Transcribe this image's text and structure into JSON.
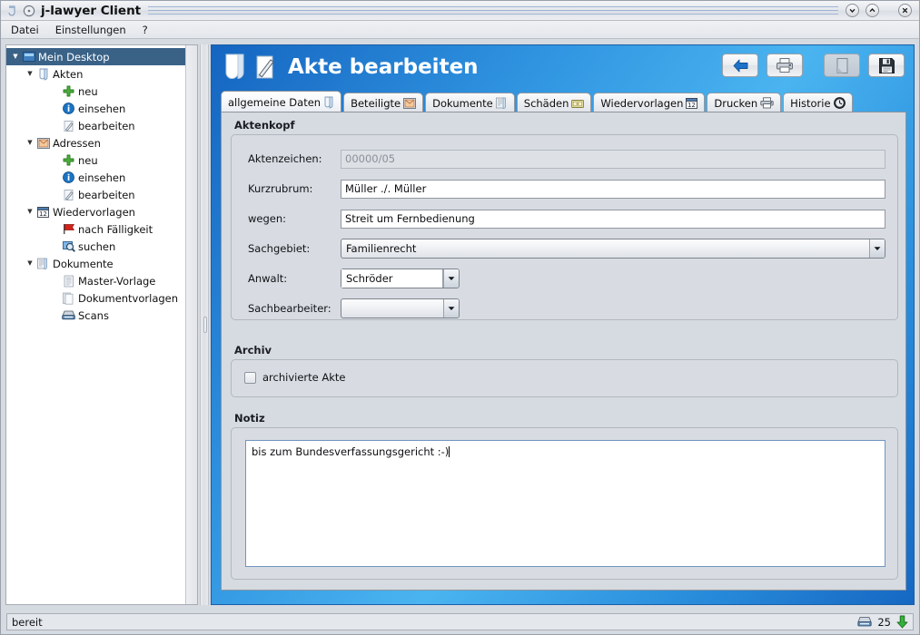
{
  "window": {
    "title": "j-lawyer Client",
    "controls": [
      {
        "name": "minimize-button",
        "glyph": "⌵"
      },
      {
        "name": "maximize-button",
        "glyph": "⌃"
      },
      {
        "name": "close-button",
        "glyph": "✕"
      }
    ]
  },
  "menubar": {
    "items": [
      {
        "label": "Datei",
        "name": "menu-datei"
      },
      {
        "label": "Einstellungen",
        "name": "menu-einstellungen"
      },
      {
        "label": "?",
        "name": "menu-help"
      }
    ]
  },
  "sidebar": {
    "items": [
      {
        "label": "Mein Desktop",
        "level": 1,
        "icon": "desktop-icon",
        "twisty": "▼",
        "selected": true
      },
      {
        "label": "Akten",
        "level": 2,
        "icon": "folder-icon",
        "twisty": "▼",
        "selected": false
      },
      {
        "label": "neu",
        "level": 3,
        "icon": "plus-icon",
        "twisty": "",
        "selected": false
      },
      {
        "label": "einsehen",
        "level": 3,
        "icon": "info-icon",
        "twisty": "",
        "selected": false
      },
      {
        "label": "bearbeiten",
        "level": 3,
        "icon": "edit-icon",
        "twisty": "",
        "selected": false
      },
      {
        "label": "Adressen",
        "level": 2,
        "icon": "addressbook-icon",
        "twisty": "▼",
        "selected": false
      },
      {
        "label": "neu",
        "level": 3,
        "icon": "plus-icon",
        "twisty": "",
        "selected": false
      },
      {
        "label": "einsehen",
        "level": 3,
        "icon": "info-icon",
        "twisty": "",
        "selected": false
      },
      {
        "label": "bearbeiten",
        "level": 3,
        "icon": "edit-icon",
        "twisty": "",
        "selected": false
      },
      {
        "label": "Wiedervorlagen",
        "level": 2,
        "icon": "calendar-icon",
        "twisty": "▼",
        "selected": false
      },
      {
        "label": "nach Fälligkeit",
        "level": 3,
        "icon": "flag-icon",
        "twisty": "",
        "selected": false
      },
      {
        "label": "suchen",
        "level": 3,
        "icon": "search-icon",
        "twisty": "",
        "selected": false
      },
      {
        "label": "Dokumente",
        "level": 2,
        "icon": "documents-icon",
        "twisty": "▼",
        "selected": false
      },
      {
        "label": "Master-Vorlage",
        "level": 3,
        "icon": "document-icon",
        "twisty": "",
        "selected": false
      },
      {
        "label": "Dokumentvorlagen",
        "level": 3,
        "icon": "templates-icon",
        "twisty": "",
        "selected": false
      },
      {
        "label": "Scans",
        "level": 3,
        "icon": "scanner-icon",
        "twisty": "",
        "selected": false
      }
    ]
  },
  "header": {
    "title": "Akte bearbeiten",
    "buttons": [
      {
        "name": "back-button",
        "icon": "back-arrow-icon",
        "disabled": false
      },
      {
        "name": "print-button",
        "icon": "printer-icon",
        "disabled": false
      },
      {
        "name": "page-button",
        "icon": "page-icon",
        "disabled": true
      },
      {
        "name": "save-button",
        "icon": "floppy-disk-icon",
        "disabled": false
      }
    ]
  },
  "tabs": [
    {
      "label": "allgemeine Daten",
      "icon": "folder-icon",
      "active": true,
      "name": "tab-allgemeine-daten"
    },
    {
      "label": "Beteiligte",
      "icon": "addressbook-icon",
      "active": false,
      "name": "tab-beteiligte"
    },
    {
      "label": "Dokumente",
      "icon": "documents-icon",
      "active": false,
      "name": "tab-dokumente"
    },
    {
      "label": "Schäden",
      "icon": "money-icon",
      "active": false,
      "name": "tab-schaeden"
    },
    {
      "label": "Wiedervorlagen",
      "icon": "calendar-icon",
      "active": false,
      "name": "tab-wiedervorlagen"
    },
    {
      "label": "Drucken",
      "icon": "printer-icon",
      "active": false,
      "name": "tab-drucken"
    },
    {
      "label": "Historie",
      "icon": "clock-icon",
      "active": false,
      "name": "tab-historie"
    }
  ],
  "aktenkopf": {
    "title": "Aktenkopf",
    "fields": {
      "aktenzeichen_label": "Aktenzeichen:",
      "aktenzeichen_value": "00000/05",
      "kurzrubrum_label": "Kurzrubrum:",
      "kurzrubrum_value": "Müller ./. Müller",
      "wegen_label": "wegen:",
      "wegen_value": "Streit um Fernbedienung",
      "sachgebiet_label": "Sachgebiet:",
      "sachgebiet_value": "Familienrecht",
      "anwalt_label": "Anwalt:",
      "anwalt_value": "Schröder",
      "sachbearbeiter_label": "Sachbearbeiter:",
      "sachbearbeiter_value": ""
    }
  },
  "archiv": {
    "title": "Archiv",
    "checkbox_label": "archivierte Akte",
    "checked": false
  },
  "notiz": {
    "title": "Notiz",
    "value": "bis zum Bundesverfassungsgericht :-)"
  },
  "statusbar": {
    "text": "bereit",
    "scan_count": "25",
    "scanner_icon": "scanner-icon",
    "download_icon": "down-arrow-icon"
  },
  "colors": {
    "header_blue": "#2f93e0",
    "selection": "#3a6287",
    "panel_bg": "#d6dae1"
  }
}
